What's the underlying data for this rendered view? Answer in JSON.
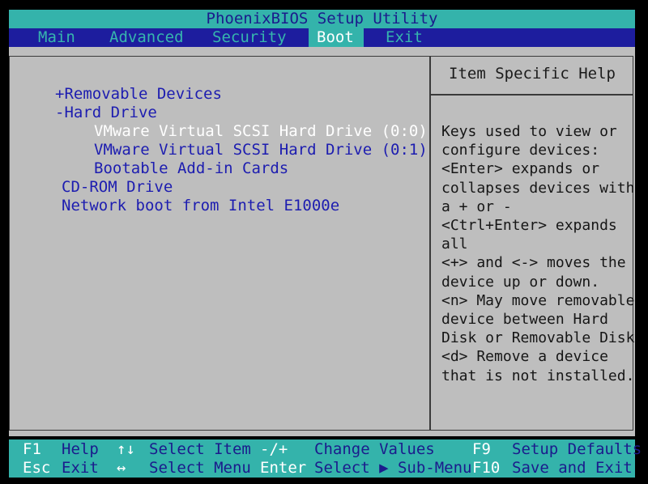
{
  "title": "PhoenixBIOS Setup Utility",
  "menu": {
    "items": [
      "Main",
      "Advanced",
      "Security",
      "Boot",
      "Exit"
    ],
    "active": "Boot"
  },
  "boot_list": [
    {
      "label": "+Removable Devices"
    },
    {
      "label": "-Hard Drive"
    },
    {
      "label": "VMware Virtual SCSI Hard Drive (0:0)",
      "selected": true
    },
    {
      "label": "VMware Virtual SCSI Hard Drive (0:1)"
    },
    {
      "label": "Bootable Add-in Cards"
    },
    {
      "label": "CD-ROM Drive"
    },
    {
      "label": "Network boot from Intel E1000e"
    }
  ],
  "help": {
    "title": "Item Specific Help",
    "lines": [
      "Keys used to view or",
      "configure devices:",
      "<Enter> expands or",
      "collapses devices with",
      "a + or -",
      "<Ctrl+Enter> expands",
      "all",
      "<+> and <-> moves the",
      "device up or down.",
      "<n> May move removable",
      "device between Hard",
      "Disk or Removable Disk",
      "<d> Remove a device",
      "that is not installed."
    ]
  },
  "status": {
    "row1": [
      {
        "key": "F1",
        "desc": "Help"
      },
      {
        "key": "↑↓",
        "desc": "Select Item"
      },
      {
        "key": "-/+",
        "desc": "Change Values"
      },
      {
        "key": "F9",
        "desc": "Setup Defaults"
      }
    ],
    "row2": [
      {
        "key": "Esc",
        "desc": "Exit"
      },
      {
        "key": "↔",
        "desc": "Select Menu"
      },
      {
        "key": "Enter",
        "desc": "Select ▶ Sub-Menu"
      },
      {
        "key": "F10",
        "desc": "Save and Exit"
      }
    ]
  },
  "colors": {
    "menu_bar_bg": "#1d1d9e",
    "cyan": "#34b3ab",
    "panel_bg": "#bebebe",
    "item_blue": "#1d1db0"
  }
}
